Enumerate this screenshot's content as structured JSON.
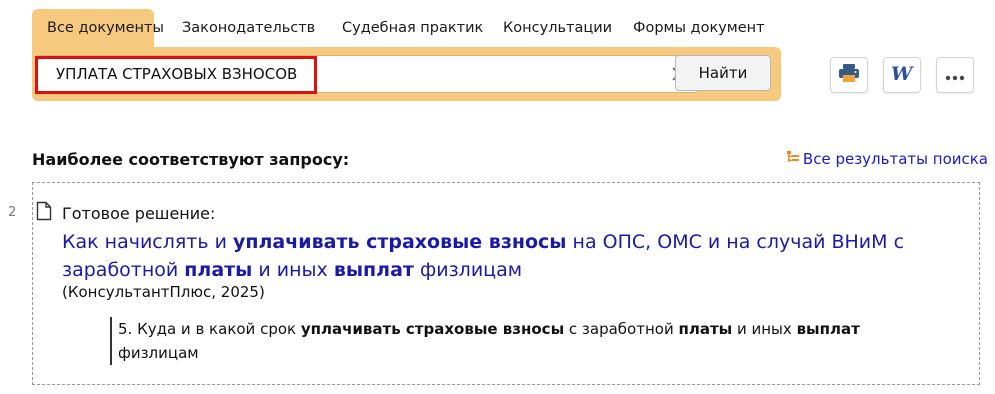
{
  "tabs": [
    {
      "label": "Все документы",
      "active": true
    },
    {
      "label": "Законодательств",
      "active": false
    },
    {
      "label": "Судебная практик",
      "active": false
    },
    {
      "label": "Консультации",
      "active": false
    },
    {
      "label": "Формы документ",
      "active": false
    }
  ],
  "search": {
    "value": "УПЛАТА СТРАХОВЫХ ВЗНОСОВ",
    "find_label": "Найти",
    "clear_icon": "close-icon"
  },
  "toolbar": {
    "print_icon": "printer-icon",
    "word_icon": "word-export-icon",
    "more_icon": "more-icon"
  },
  "results": {
    "heading": "Наиболее соответствуют запросу:",
    "all_results_label": "Все результаты поиска",
    "items": [
      {
        "number": "2",
        "type": "Готовое решение:",
        "title_parts": [
          "Как начислять и ",
          "уплачивать страховые взносы",
          " на ОПС, ОМС и на случай ВНиМ с заработной ",
          "платы",
          " и иных ",
          "выплат",
          " физлицам"
        ],
        "source": "(КонсультантПлюс, 2025)",
        "snippet_parts": [
          "5. Куда и в какой срок ",
          "уплачивать страховые взносы",
          " с заработной ",
          "платы",
          " и иных ",
          "выплат",
          " физлицам"
        ]
      }
    ]
  },
  "colors": {
    "accent": "#f7c97f",
    "link": "#1a1aa8",
    "highlight_border": "#e01010"
  }
}
